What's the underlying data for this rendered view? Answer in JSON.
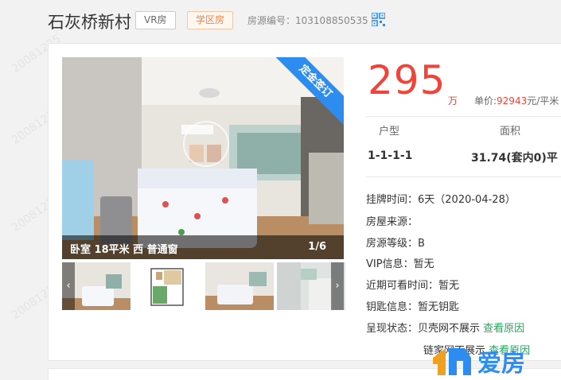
{
  "header": {
    "title": "石灰桥新村",
    "tag_vr": "VR房",
    "tag_school": "学区房",
    "listing_label": "房源编号：",
    "listing_id": "103108850535"
  },
  "photo": {
    "ribbon": "定金签订",
    "caption": "卧室 18平米 西 普通窗",
    "counter": "1/6",
    "thumb_prev": "‹",
    "thumb_next": "›"
  },
  "price": {
    "total": "295",
    "unit": "万",
    "unit_price_label": "单价:",
    "unit_price_value": "92943",
    "unit_price_suffix": "元/平米"
  },
  "layout": {
    "col1_label": "户型",
    "col1_value": "1-1-1-1",
    "col2_label": "面积",
    "col2_value": "31.74(套内0)平"
  },
  "info": [
    {
      "label": "挂牌时间：",
      "value": "6天（2020-04-28）"
    },
    {
      "label": "房屋来源：",
      "value": ""
    },
    {
      "label": "房源等级：",
      "value": "B"
    },
    {
      "label": "VIP信息：",
      "value": "暂无"
    },
    {
      "label": "近期可看时间：",
      "value": "暂无"
    },
    {
      "label": "钥匙信息：",
      "value": "暂无钥匙"
    },
    {
      "label": "呈现状态：",
      "value": "贝壳网不展示",
      "link": "查看原因"
    },
    {
      "label": "",
      "value": "链家网不展示",
      "link": "查看原因"
    }
  ],
  "watermark": "20081225",
  "logo": {
    "text": "爱房"
  },
  "colors": {
    "price": "#f0443a",
    "link": "#2aa55e",
    "ribbon": "#2d8cf0"
  }
}
